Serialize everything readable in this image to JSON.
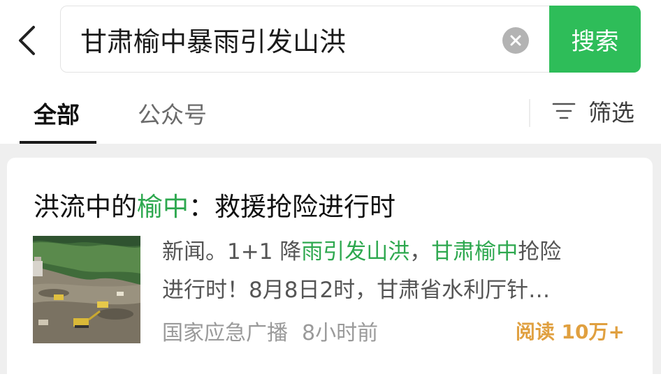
{
  "search": {
    "query": "甘肃榆中暴雨引发山洪",
    "button_label": "搜索"
  },
  "tabs": [
    {
      "label": "全部",
      "active": true
    },
    {
      "label": "公众号",
      "active": false
    }
  ],
  "filter": {
    "label": "筛选",
    "icon": "filter-lines-icon"
  },
  "colors": {
    "accent": "#2ebd59",
    "highlight": "#2ea84f",
    "reads": "#e0a040"
  },
  "result": {
    "title_parts": [
      "洪流中的",
      "榆中",
      "：救援抢险进行时"
    ],
    "snippet_line1_parts": [
      "新闻。1+1 降",
      "雨引发山洪",
      "，",
      "甘肃榆中",
      "抢险"
    ],
    "snippet_line2": "进行时！8月8日2时，甘肃省水利厅针…",
    "source": "国家应急广播",
    "time": "8小时前",
    "reads": "阅读 10万+"
  }
}
